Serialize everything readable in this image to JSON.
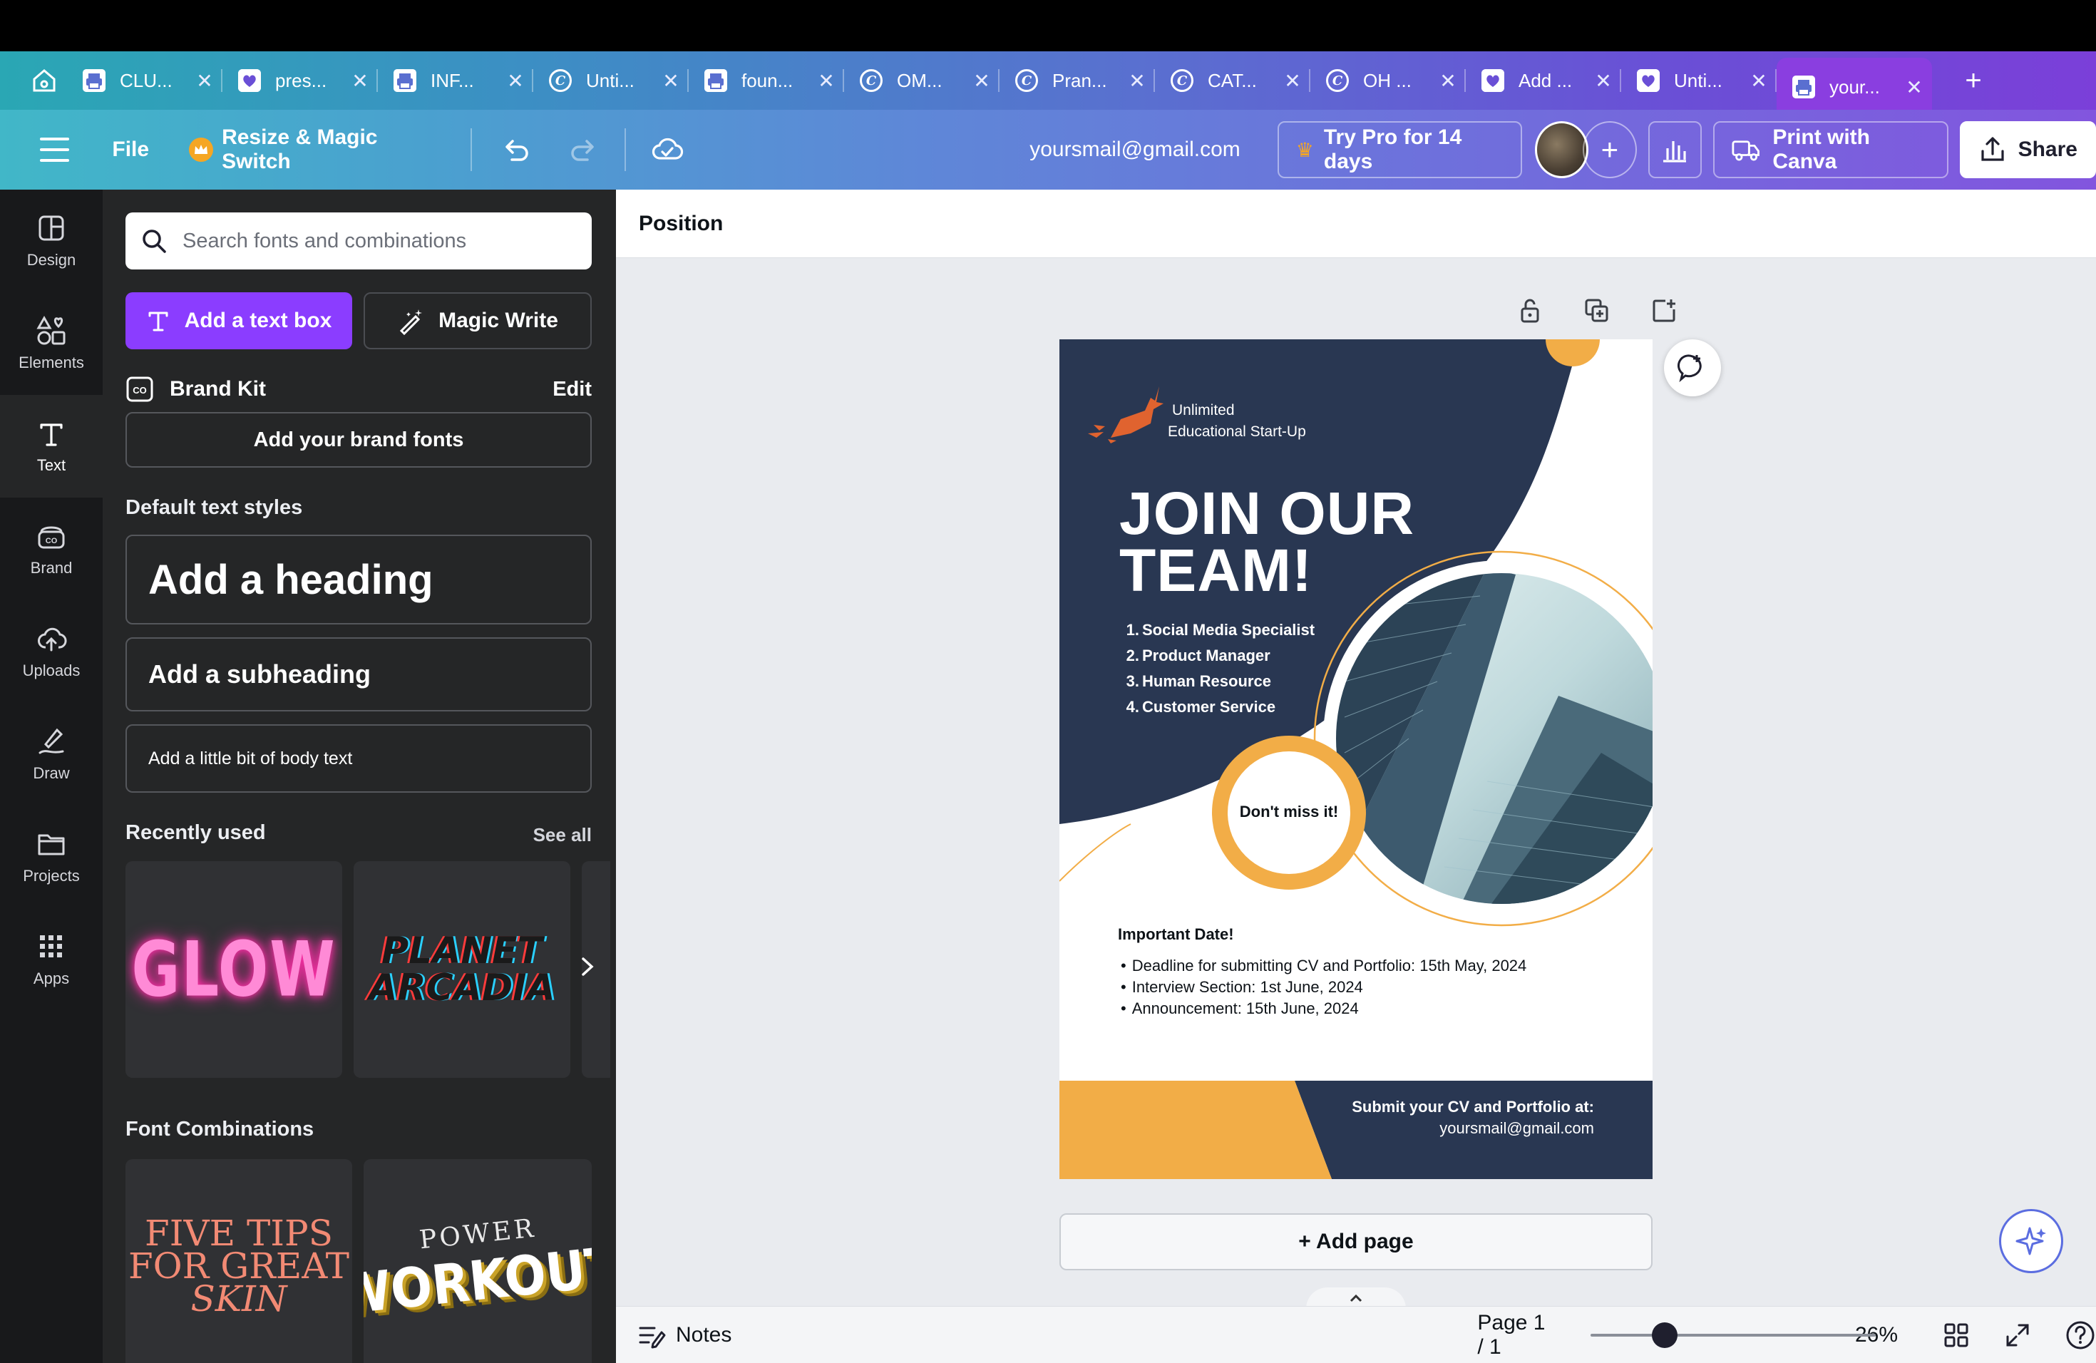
{
  "tabs": [
    {
      "title": "CLU...",
      "icon": "printer-icon"
    },
    {
      "title": "pres...",
      "icon": "heart-icon"
    },
    {
      "title": "INF...",
      "icon": "printer-icon"
    },
    {
      "title": "Unti...",
      "icon": "canva-icon"
    },
    {
      "title": "foun...",
      "icon": "printer-icon"
    },
    {
      "title": "OM...",
      "icon": "canva-icon"
    },
    {
      "title": "Pran...",
      "icon": "canva-icon"
    },
    {
      "title": "CAT...",
      "icon": "canva-icon"
    },
    {
      "title": "OH ...",
      "icon": "canva-icon"
    },
    {
      "title": "Add ...",
      "icon": "heart-icon"
    },
    {
      "title": "Unti...",
      "icon": "heart-icon"
    },
    {
      "title": "your...",
      "icon": "printer-icon"
    }
  ],
  "toolbar": {
    "file": "File",
    "resize": "Resize & Magic Switch",
    "email": "yoursmail@gmail.com",
    "try_pro": "Try Pro for 14 days",
    "print": "Print with Canva",
    "share": "Share"
  },
  "rail": [
    {
      "label": "Design"
    },
    {
      "label": "Elements"
    },
    {
      "label": "Text"
    },
    {
      "label": "Brand"
    },
    {
      "label": "Uploads"
    },
    {
      "label": "Draw"
    },
    {
      "label": "Projects"
    },
    {
      "label": "Apps"
    }
  ],
  "panel": {
    "search_placeholder": "Search fonts and combinations",
    "add_textbox": "Add a text box",
    "magic_write": "Magic Write",
    "brand_kit": "Brand Kit",
    "edit": "Edit",
    "add_brand_fonts": "Add your brand fonts",
    "default_styles_title": "Default text styles",
    "heading": "Add a heading",
    "subheading": "Add a subheading",
    "body": "Add a little bit of body text",
    "recently_used": "Recently used",
    "see_all": "See all",
    "recent": [
      "GLOW",
      "PLANET",
      "ARCADIA"
    ],
    "font_combinations": "Font Combinations",
    "combo1": [
      "FIVE TIPS",
      "FOR GREAT",
      "SKIN"
    ],
    "combo2": [
      "POWER",
      "WORKOUT"
    ]
  },
  "workspace": {
    "position": "Position",
    "add_page": "+ Add page",
    "notes": "Notes",
    "page_label": "Page 1 / 1",
    "zoom": "26%",
    "zoom_fraction": 0.26
  },
  "poster": {
    "logo_line1": "Unlimited",
    "logo_line2": "Educational Start-Up",
    "headline1": "JOIN OUR",
    "headline2": "TEAM!",
    "roles": [
      {
        "num": "1.",
        "text": "Social Media Specialist"
      },
      {
        "num": "2.",
        "text": "Product Manager"
      },
      {
        "num": "3.",
        "text": "Human Resource"
      },
      {
        "num": "4.",
        "text": "Customer Service"
      }
    ],
    "badge": "Don't miss it!",
    "important": "Important Date!",
    "dates": [
      "Deadline for submitting CV and Portfolio: 15th May, 2024",
      "Interview Section: 1st June, 2024",
      "Announcement: 15th June, 2024"
    ],
    "submit_label": "Submit your CV and Portfolio at:",
    "submit_email": "yoursmail@gmail.com",
    "colors": {
      "navy": "#293752",
      "orange": "#f2ad47",
      "accent": "#8b3dff"
    }
  }
}
